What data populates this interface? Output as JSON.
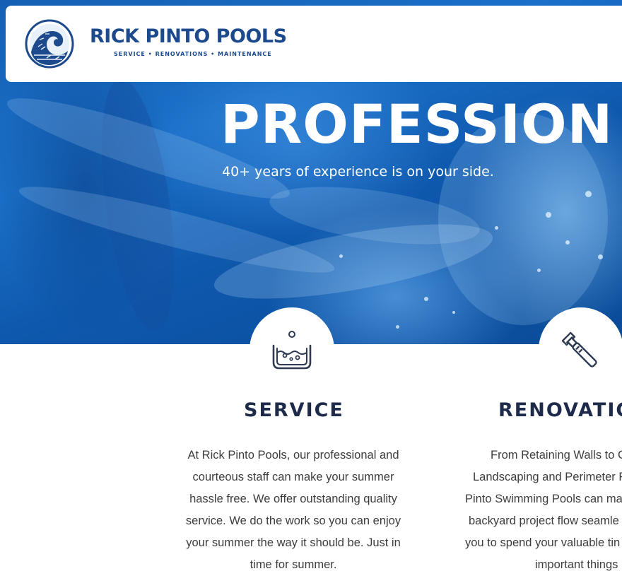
{
  "header": {
    "brand_name": "RICK PINTO POOLS",
    "tagline": "SERVICE  •  RENOVATIONS  •  MAINTENANCE",
    "logo_icon": "wave-logo-icon",
    "brand_color": "#1c4a8c"
  },
  "hero": {
    "title": "PROFESSION",
    "subtitle": "40+ years of experience is on your side.",
    "background_color": "#1565c0"
  },
  "services": [
    {
      "icon": "hot-tub-icon",
      "title": "SERVICE",
      "lines": [
        "At Rick Pinto Pools, our professional and",
        "courteous staff can make your summer",
        "hassle free. We offer outstanding quality",
        "service. We do the work so you can enjoy",
        "your summer the way it should be. Just in",
        "time for summer."
      ]
    },
    {
      "icon": "pipe-wrench-icon",
      "title": "RENOVATIC",
      "lines": [
        "From Retaining Walls to C",
        "Landscaping and Perimeter F",
        "Pinto Swimming Pools can ma",
        "backyard project flow seamle",
        "you to spend your valuable tin",
        "important things"
      ]
    }
  ],
  "colors": {
    "title_text": "#1e2a4a",
    "body_text": "#3d3d3d",
    "icon_stroke": "#2d3a52"
  }
}
